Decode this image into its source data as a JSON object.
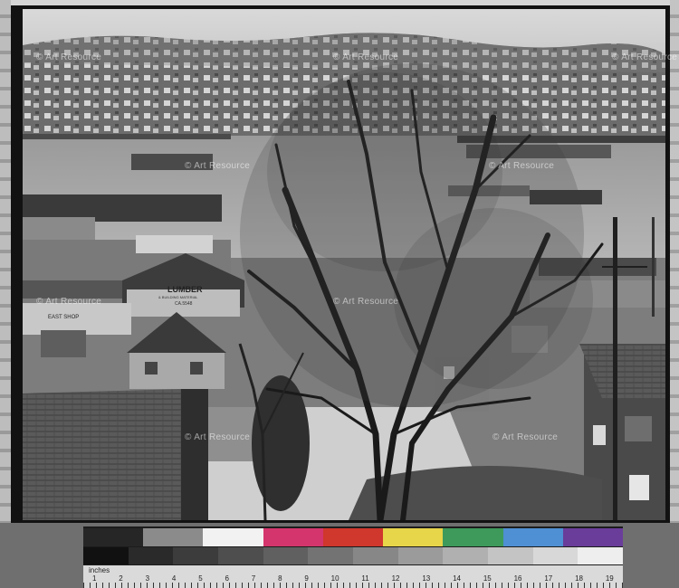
{
  "photo": {
    "sign_lumber": "LUMBER",
    "sign_lumber_sub": "& BUILDING MATERIAL",
    "sign_lumber_phone": "CA.5548",
    "sign_shop": "EAST SHOP"
  },
  "watermarks": {
    "text": "© Art Resource"
  },
  "color_checker": {
    "swatches": [
      "#262626",
      "#8b8b8b",
      "#f2f2f2",
      "#d4356c",
      "#d0372d",
      "#e7d54a",
      "#3e9a5b",
      "#4f8fd3",
      "#6a3d9a"
    ],
    "grays": [
      "#111111",
      "#2a2a2a",
      "#3c3c3c",
      "#4e4e4e",
      "#606060",
      "#737373",
      "#878787",
      "#9b9b9b",
      "#b0b0b0",
      "#c4c4c4",
      "#d8d8d8",
      "#eeeeee"
    ],
    "ruler_label": "inches",
    "ruler_numbers": [
      "1",
      "2",
      "3",
      "4",
      "5",
      "6",
      "7",
      "8",
      "9",
      "10",
      "11",
      "12",
      "13",
      "14",
      "15",
      "16",
      "17",
      "18",
      "19"
    ]
  }
}
